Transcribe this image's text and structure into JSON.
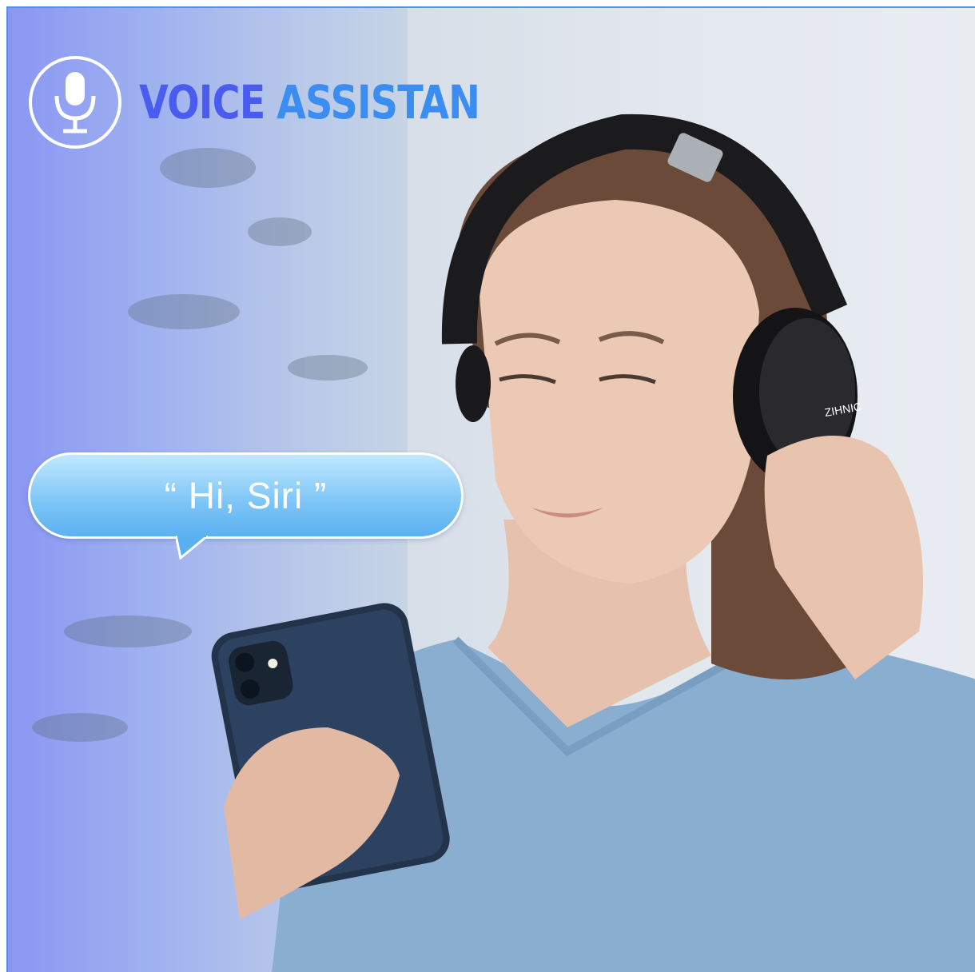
{
  "headline": {
    "word1": "VOICE",
    "word2": "ASSISTAN"
  },
  "bubble": {
    "text": "“ Hi, Siri ”"
  },
  "headphone_brand": "ZIHNIC",
  "icons": {
    "badge": "microphone-icon"
  },
  "colors": {
    "headline_dark": "#4a5cf0",
    "headline_light": "#3b8df2",
    "bubble": "#7cc4f6"
  }
}
